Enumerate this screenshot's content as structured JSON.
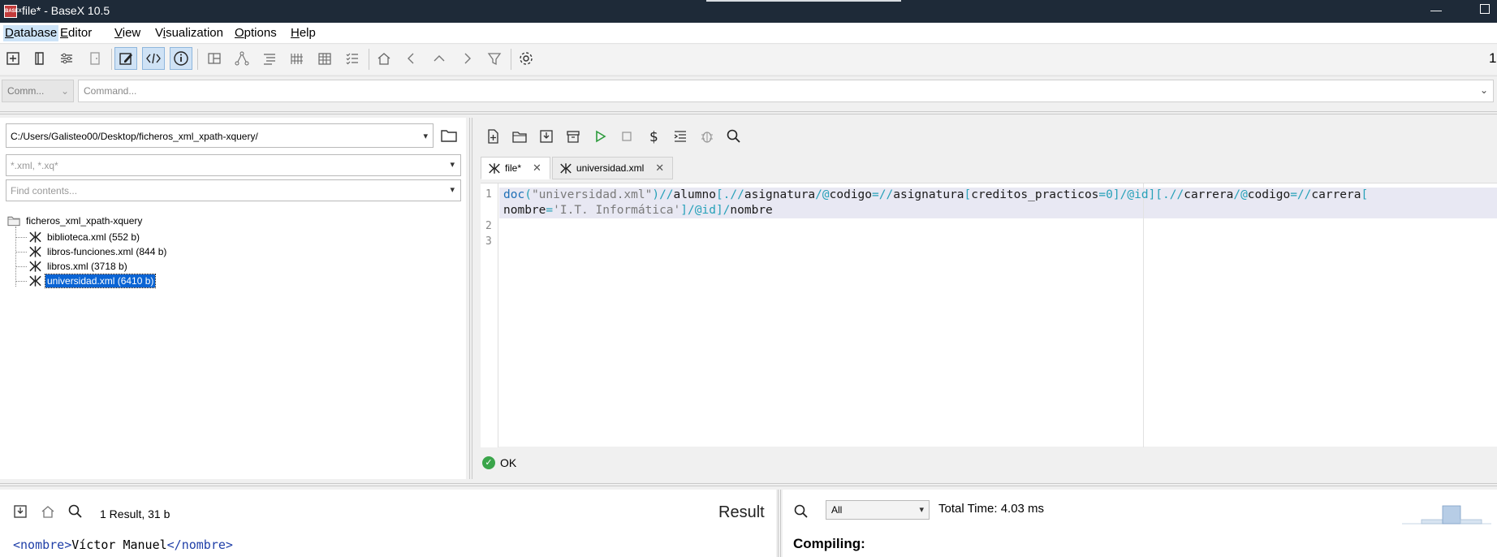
{
  "window": {
    "title": "file* - BaseX 10.5",
    "app_icon_text": "BASEX"
  },
  "menu": [
    "Database",
    "Editor",
    "View",
    "Visualization",
    "Options",
    "Help"
  ],
  "menu_underline": [
    "D",
    "E",
    "V",
    "i",
    "O",
    "H"
  ],
  "toolbar": {
    "right_text": "1"
  },
  "command": {
    "mode": "Comm...",
    "placeholder": "Command..."
  },
  "project": {
    "path": "C:/Users/Galisteo00/Desktop/ficheros_xml_xpath-xquery/",
    "filter_placeholder": "*.xml, *.xq*",
    "find_placeholder": "Find contents...",
    "root_folder": "ficheros_xml_xpath-xquery",
    "files": [
      {
        "label": "biblioteca.xml (552 b)",
        "selected": false
      },
      {
        "label": "libros-funciones.xml (844 b)",
        "selected": false
      },
      {
        "label": "libros.xml (3718 b)",
        "selected": false
      },
      {
        "label": "universidad.xml (6410 b)",
        "selected": true
      }
    ]
  },
  "editor": {
    "tabs": [
      {
        "label": "file*",
        "active": true
      },
      {
        "label": "universidad.xml",
        "active": false
      }
    ],
    "line_numbers": [
      "1",
      "2",
      "3"
    ],
    "status": "OK"
  },
  "result": {
    "count": "1 Result, 31 b",
    "title": "Result",
    "open_tag": "<nombre>",
    "value": "Víctor Manuel",
    "close_tag": "</nombre>"
  },
  "info": {
    "filter": "All",
    "total_time": "Total Time: 4.03 ms",
    "section": "Compiling:"
  },
  "colors": {
    "selection": "#0a64d4",
    "titlebar": "#1e2a38",
    "ok": "#3aa54a"
  }
}
